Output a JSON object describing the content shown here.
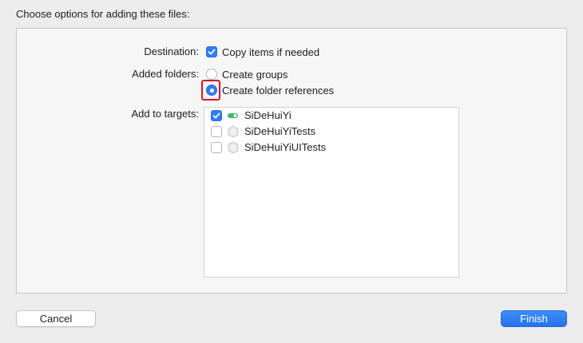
{
  "dialog": {
    "header": "Choose options for adding these files:"
  },
  "options": {
    "destination_label": "Destination:",
    "copy_items": {
      "label": "Copy items if needed",
      "checked": true
    },
    "added_folders_label": "Added folders:",
    "create_groups": {
      "label": "Create groups",
      "selected": false
    },
    "create_folder_references": {
      "label": "Create folder references",
      "selected": true
    },
    "add_to_targets_label": "Add to targets:"
  },
  "targets": [
    {
      "name": "SiDeHuiYi",
      "checked": true,
      "icon": "app-target-icon"
    },
    {
      "name": "SiDeHuiYiTests",
      "checked": false,
      "icon": "test-target-icon"
    },
    {
      "name": "SiDeHuiYiUITests",
      "checked": false,
      "icon": "test-target-icon"
    }
  ],
  "buttons": {
    "cancel": "Cancel",
    "finish": "Finish"
  },
  "colors": {
    "accent": "#2f7cf6",
    "highlight": "#d2162a",
    "app_icon": "#3cba6a"
  }
}
